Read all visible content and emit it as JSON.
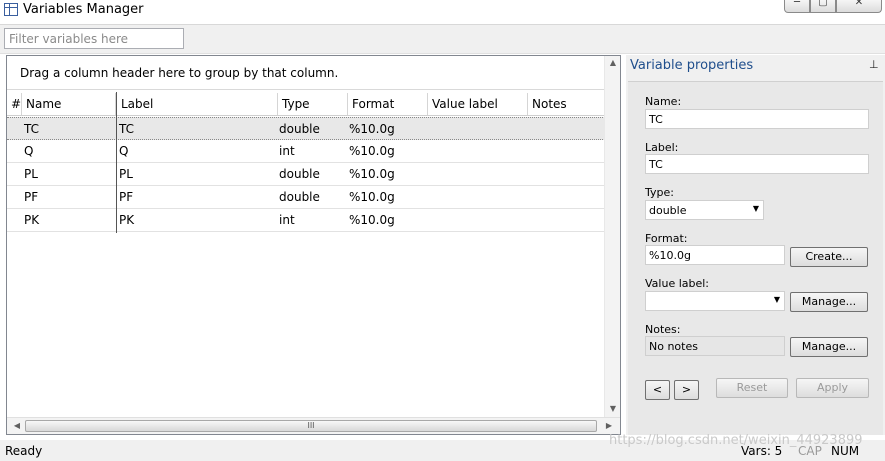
{
  "window": {
    "title": "Variables Manager"
  },
  "filter": {
    "placeholder": "Filter variables here"
  },
  "grid": {
    "group_hint": "Drag a column header here to group by that column.",
    "columns": [
      "#",
      "Name",
      "Label",
      "Type",
      "Format",
      "Value label",
      "Notes"
    ],
    "rows": [
      {
        "name": "TC",
        "label": "TC",
        "type": "double",
        "format": "%10.0g"
      },
      {
        "name": "Q",
        "label": "Q",
        "type": "int",
        "format": "%10.0g"
      },
      {
        "name": "PL",
        "label": "PL",
        "type": "double",
        "format": "%10.0g"
      },
      {
        "name": "PF",
        "label": "PF",
        "type": "double",
        "format": "%10.0g"
      },
      {
        "name": "PK",
        "label": "PK",
        "type": "int",
        "format": "%10.0g"
      }
    ],
    "hscroll_grip": "III"
  },
  "properties": {
    "title": "Variable properties",
    "pin_icon": "📌",
    "name_label": "Name:",
    "name_value": "TC",
    "label_label": "Label:",
    "label_value": "TC",
    "type_label": "Type:",
    "type_value": "double",
    "format_label": "Format:",
    "format_value": "%10.0g",
    "create_button": "Create...",
    "value_label_label": "Value label:",
    "value_label_value": "",
    "manage_button": "Manage...",
    "notes_label": "Notes:",
    "notes_value": "No notes",
    "notes_manage_button": "Manage...",
    "prev_button": "<",
    "next_button": ">",
    "reset_button": "Reset",
    "apply_button": "Apply"
  },
  "status": {
    "ready": "Ready",
    "vars": "Vars: 5",
    "cap": "CAP",
    "num": "NUM"
  },
  "watermark": "https://blog.csdn.net/weixin_44923899"
}
